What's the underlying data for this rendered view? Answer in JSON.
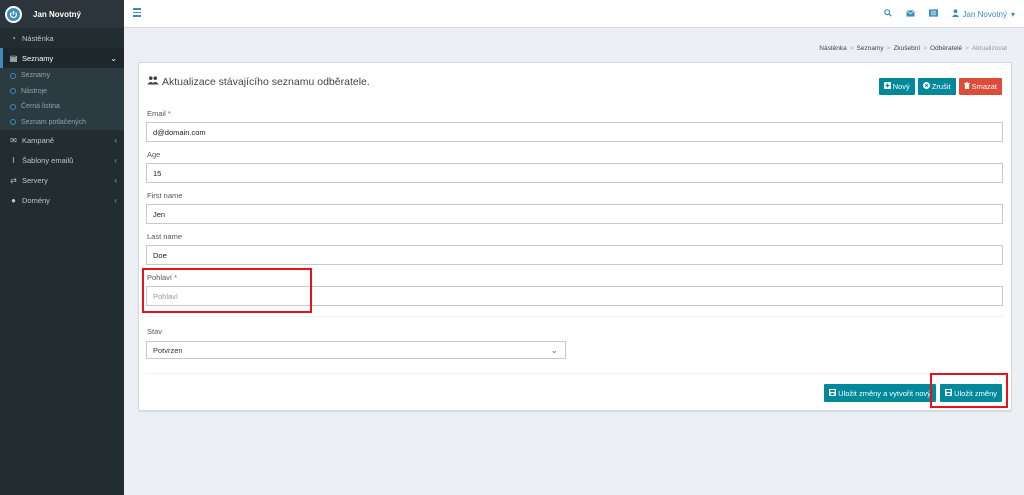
{
  "brand": {
    "name": "Jan Novotný"
  },
  "sidebar": {
    "items": [
      {
        "label": "Nástěnka",
        "icon": "dashboard-icon"
      },
      {
        "label": "Seznamy",
        "icon": "list-icon"
      },
      {
        "label": "Kampaně",
        "icon": "envelope-icon"
      },
      {
        "label": "Šablony emailů",
        "icon": "text-cursor-icon"
      },
      {
        "label": "Servery",
        "icon": "exchange-icon"
      },
      {
        "label": "Domény",
        "icon": "globe-icon"
      }
    ],
    "sub_items": [
      {
        "label": "Seznamy"
      },
      {
        "label": "Nástroje"
      },
      {
        "label": "Černá listina"
      },
      {
        "label": "Seznam potlačených"
      }
    ]
  },
  "topbar": {
    "user": "Jan Novotný"
  },
  "breadcrumb": [
    "Nástěnka",
    "Seznamy",
    "Zkušební",
    "Odběratelé",
    "Aktualizovat"
  ],
  "panel": {
    "title": "Aktualizace stávajícího seznamu odběratele.",
    "btn_new": "Nový",
    "btn_cancel": "Zrušit",
    "btn_delete": "Smazat"
  },
  "form": {
    "email": {
      "label": "Email",
      "value": "d@domain.com"
    },
    "age": {
      "label": "Age",
      "value": "15"
    },
    "first_name": {
      "label": "First name",
      "value": "Jen"
    },
    "last_name": {
      "label": "Last name",
      "value": "Doe"
    },
    "gender": {
      "label": "Pohlaví",
      "placeholder": "Pohlaví"
    },
    "status": {
      "label": "Stav",
      "selected": "Potvrzen"
    }
  },
  "footer": {
    "save_new": "Uložit změny a vytvořit nový",
    "save": "Uložit změny"
  },
  "colors": {
    "accent": "#00899b",
    "danger": "#dd4b39",
    "sidebar": "#222d32",
    "highlight": "#e8121d"
  }
}
